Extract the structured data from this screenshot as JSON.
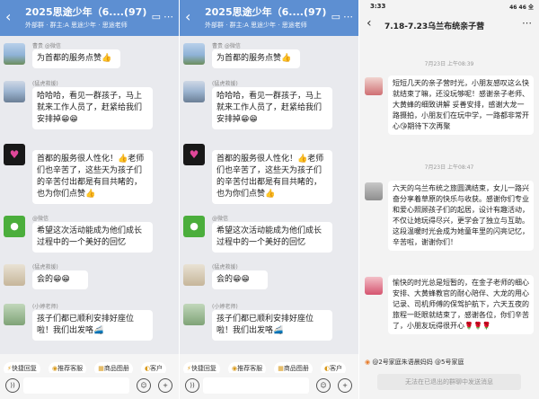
{
  "chat": {
    "title": "2025思途少年（6....",
    "count": "(97)",
    "subtitle": "外部群 · 群主:A 思途少年 · 思途老师",
    "back_icon": "back-arrow-icon",
    "video_icon": "video-call-icon",
    "more_icon": "more-icon",
    "messages": [
      {
        "name": "曹贵 @微信",
        "text": "为首都的服务点赞👍"
      },
      {
        "name": "(猛虎救援)",
        "text": "哈哈哈，看见一群孩子，马上就来工作人员了，赶紧给我们安排掉😁😁"
      },
      {
        "name": "",
        "text": "首都的服务很人性化！👍老师们也辛苦了，这些天为孩子们的辛苦付出都是有目共睹的，也为你们点赞👍"
      },
      {
        "name": "@微信",
        "text": "希望这次活动能成为他们成长过程中的一个美好的回忆"
      },
      {
        "name": "(猛虎救援)",
        "text": "会的😁😁"
      },
      {
        "name": "(小婷老师)",
        "text": "孩子们都已顺利安排好座位啦！我们出发咯🚄"
      }
    ],
    "quick": [
      "快捷回复",
      "推荐客服",
      "商品图册",
      "客户"
    ]
  },
  "phone3": {
    "time": "3:33",
    "status": "46 46 全",
    "title": "7.18-7.23乌兰布统亲子营",
    "stamps": [
      "7月23日 上午08:39",
      "7月23日 上午08:47"
    ],
    "messages": [
      {
        "text": "短短几天的亲子营时光，小朋友感叹这么快就结束了嘛，还没玩够呢！感谢亲子老师、大黄蜂的细致讲解 妥善安排，感谢大龙一路摄拍，小朋友们在玩中学，一路都非常开心😘期待下次再聚"
      },
      {
        "text": "六天的乌兰布统之旅圆满结束，女儿一路兴奋分享着草原的快乐与收获。感谢你们专业和爱心照顾孩子们的起居，设计有趣活动，不仅让她玩得尽兴，更学会了独立与互助。这段温暖时光会成为她童年里的闪亮记忆，辛苦啦，谢谢你们！"
      },
      {
        "text": "愉快的时光总是短暂的，在金子老师的细心安排、大黄蜂教官的耐心陪伴、大龙的用心记录、司机师傅的保驾护航下，六天五夜的旅程一眨眼就结束了，感谢各位，你们辛苦了，小朋友玩得很开心🌹🌹🌹"
      }
    ],
    "mention": "@2号家庭朱语晨妈妈 @5号家庭",
    "disabled": "无法在已退出的群聊中发送消息"
  }
}
